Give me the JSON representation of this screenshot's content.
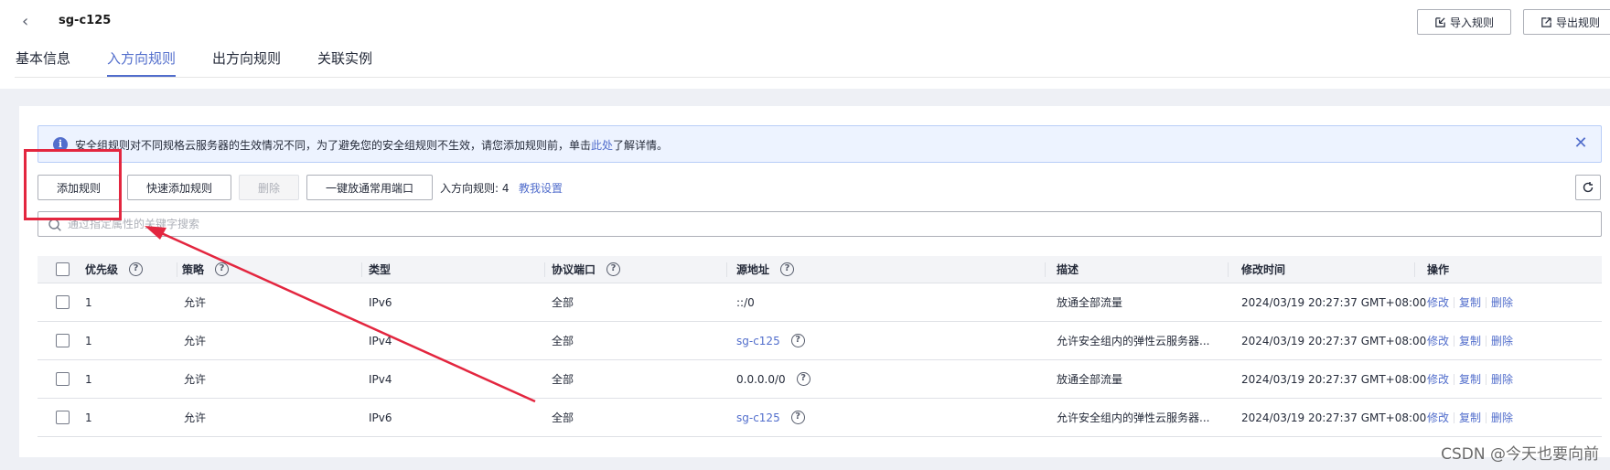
{
  "header": {
    "title": "sg-c125",
    "import_label": "导入规则",
    "export_label": "导出规则"
  },
  "tabs": [
    {
      "label": "基本信息",
      "active": false
    },
    {
      "label": "入方向规则",
      "active": true
    },
    {
      "label": "出方向规则",
      "active": false
    },
    {
      "label": "关联实例",
      "active": false
    }
  ],
  "notice": {
    "text_before": "安全组规则对不同规格云服务器的生效情况不同，为了避免您的安全组规则不生效，请您添加规则前，单击",
    "link": "此处",
    "text_after": "了解详情。"
  },
  "toolbar": {
    "add_rule": "添加规则",
    "quick_add": "快速添加规则",
    "delete": "删除",
    "open_ports": "一键放通常用端口",
    "count_label": "入方向规则: 4",
    "teach_link": "教我设置"
  },
  "search": {
    "placeholder": "通过指定属性的关键字搜索"
  },
  "table": {
    "columns": [
      "优先级",
      "策略",
      "类型",
      "协议端口",
      "源地址",
      "描述",
      "修改时间",
      "操作"
    ],
    "rows": [
      {
        "priority": "1",
        "policy": "允许",
        "type": "IPv6",
        "port": "全部",
        "source": "::/0",
        "source_link": false,
        "source_help": false,
        "desc": "放通全部流量",
        "time": "2024/03/19 20:27:37 GMT+08:00"
      },
      {
        "priority": "1",
        "policy": "允许",
        "type": "IPv4",
        "port": "全部",
        "source": "sg-c125",
        "source_link": true,
        "source_help": true,
        "desc": "允许安全组内的弹性云服务器...",
        "time": "2024/03/19 20:27:37 GMT+08:00"
      },
      {
        "priority": "1",
        "policy": "允许",
        "type": "IPv4",
        "port": "全部",
        "source": "0.0.0.0/0",
        "source_link": false,
        "source_help": true,
        "desc": "放通全部流量",
        "time": "2024/03/19 20:27:37 GMT+08:00"
      },
      {
        "priority": "1",
        "policy": "允许",
        "type": "IPv6",
        "port": "全部",
        "source": "sg-c125",
        "source_link": true,
        "source_help": true,
        "desc": "允许安全组内的弹性云服务器...",
        "time": "2024/03/19 20:27:37 GMT+08:00"
      }
    ],
    "actions": {
      "edit": "修改",
      "copy": "复制",
      "delete": "删除"
    }
  },
  "watermark": "CSDN @今天也要向前",
  "colors": {
    "accent": "#526ecc",
    "annotation": "#e3263f"
  }
}
